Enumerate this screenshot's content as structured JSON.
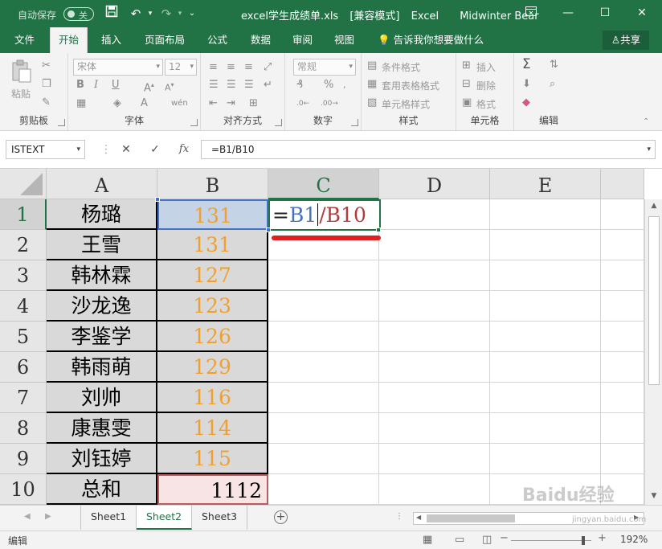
{
  "titlebar": {
    "autosave_label": "自动保存",
    "autosave_state": "关",
    "title": "excel学生成绩单.xls",
    "mode": "[兼容模式]",
    "app": "Excel",
    "user": "Midwinter Bear"
  },
  "tabs": [
    "文件",
    "开始",
    "插入",
    "页面布局",
    "公式",
    "数据",
    "审阅",
    "视图"
  ],
  "active_tab": "开始",
  "tellme": "告诉我你想要做什么",
  "share": "共享",
  "ribbon": {
    "clipboard": {
      "label": "剪贴板",
      "paste": "粘贴"
    },
    "font": {
      "label": "字体",
      "font_name": "宋体",
      "font_size": "12"
    },
    "alignment": {
      "label": "对齐方式"
    },
    "number": {
      "label": "数字",
      "format": "常规"
    },
    "styles": {
      "label": "样式",
      "conditional": "条件格式",
      "table": "套用表格格式",
      "cell": "单元格样式"
    },
    "cells": {
      "label": "单元格",
      "insert": "插入",
      "delete": "删除",
      "format": "格式"
    },
    "editing": {
      "label": "编辑"
    }
  },
  "formula_bar": {
    "name_box": "ISTEXT",
    "formula": "=B1/B10"
  },
  "columns": [
    "A",
    "B",
    "C",
    "D",
    "E"
  ],
  "rows": [
    {
      "n": "1",
      "name": "杨璐",
      "score": "131"
    },
    {
      "n": "2",
      "name": "王雪",
      "score": "131"
    },
    {
      "n": "3",
      "name": "韩林霖",
      "score": "127"
    },
    {
      "n": "4",
      "name": "沙龙逸",
      "score": "123"
    },
    {
      "n": "5",
      "name": "李鉴学",
      "score": "126"
    },
    {
      "n": "6",
      "name": "韩雨萌",
      "score": "129"
    },
    {
      "n": "7",
      "name": "刘帅",
      "score": "116"
    },
    {
      "n": "8",
      "name": "康惠雯",
      "score": "114"
    },
    {
      "n": "9",
      "name": "刘钰婷",
      "score": "115"
    },
    {
      "n": "10",
      "name": "总和",
      "score": "1112"
    }
  ],
  "active_cell": {
    "eq": "=",
    "ref1": "B1",
    "sep": "/",
    "ref2": "B10"
  },
  "sheets": [
    "Sheet1",
    "Sheet2",
    "Sheet3"
  ],
  "active_sheet": "Sheet2",
  "status": {
    "mode": "编辑",
    "zoom": "192%"
  },
  "watermark": {
    "brand": "Baidu经验",
    "url": "jingyan.baidu.com"
  },
  "colors": {
    "excel_green": "#217346",
    "score": "#f0a030",
    "ref1": "#4472c4",
    "ref2": "#b23b3b"
  }
}
